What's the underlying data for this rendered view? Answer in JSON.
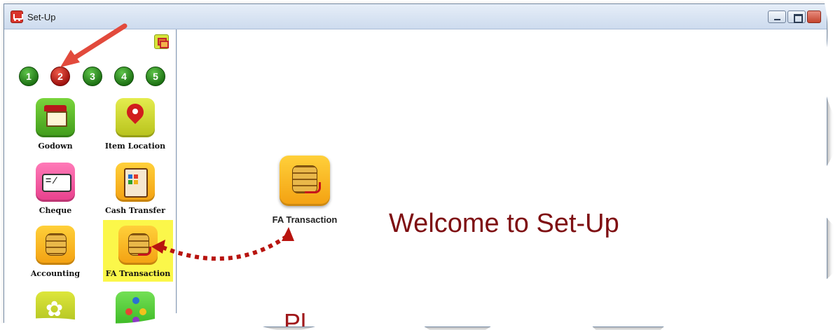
{
  "window": {
    "title": "Set-Up",
    "controls": [
      "minimize",
      "maximize",
      "close"
    ]
  },
  "sidebar": {
    "toggle_icon": "restore-windows-icon",
    "pages": [
      {
        "label": "1",
        "active": false
      },
      {
        "label": "2",
        "active": true
      },
      {
        "label": "3",
        "active": false
      },
      {
        "label": "4",
        "active": false
      },
      {
        "label": "5",
        "active": false
      }
    ],
    "tiles": [
      {
        "label": "Godown",
        "icon": "house-icon"
      },
      {
        "label": "Item Location",
        "icon": "map-pin-icon"
      },
      {
        "label": "Cheque",
        "icon": "cheque-icon"
      },
      {
        "label": "Cash Transfer",
        "icon": "cash-register-icon"
      },
      {
        "label": "Accounting",
        "icon": "coins-icon"
      },
      {
        "label": "FA Transaction",
        "icon": "coins-transfer-icon",
        "selected": true
      },
      {
        "label": "",
        "icon": "leaf-icon"
      },
      {
        "label": "",
        "icon": "network-icon"
      }
    ]
  },
  "main": {
    "shortcut": {
      "label": "FA Transaction",
      "icon": "coins-transfer-icon"
    },
    "welcome": "Welcome to Set-Up",
    "bottom_text": "Pl"
  },
  "colors": {
    "accent_red": "#7e0f12",
    "highlight_yellow": "#fbf74a",
    "annotation_red": "#c9322a"
  }
}
